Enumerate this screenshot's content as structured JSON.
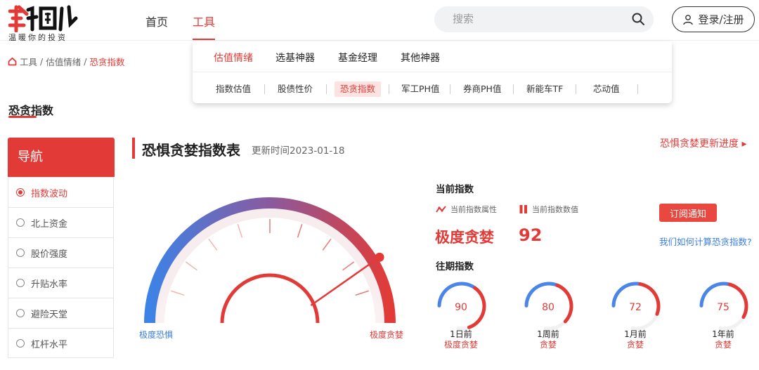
{
  "brand": {
    "logo_text": "韭圈儿",
    "slogan": "温暖你的投资"
  },
  "nav": {
    "home": "首页",
    "tools": "工具"
  },
  "search": {
    "placeholder": "搜索"
  },
  "auth": {
    "login_label": "登录/注册"
  },
  "dropdown": {
    "main": [
      "估值情绪",
      "选基神器",
      "基金经理",
      "其他神器"
    ],
    "sub": [
      "指数估值",
      "股债性价",
      "恐贪指数",
      "军工PH值",
      "券商PH值",
      "新能车TF",
      "芯动值"
    ]
  },
  "breadcrumb": [
    "工具",
    "估值情绪",
    "恐贪指数"
  ],
  "page_title": "恐贪指数",
  "sidebar": {
    "title": "导航",
    "items": [
      "指数波动",
      "北上资金",
      "股价强度",
      "升贴水率",
      "避险天堂",
      "杠杆水平"
    ]
  },
  "section": {
    "title": "恐惧贪婪指数表",
    "update_time": "更新时间2023-01-18",
    "progress_link": "恐惧贪婪更新进度 ▸"
  },
  "gauge": {
    "min_label": "极度恐惧",
    "max_label": "极度贪婪",
    "value": 92,
    "max": 100
  },
  "current": {
    "title": "当前指数",
    "attr_label": "当前指数属性",
    "value_label": "当前指数数值",
    "attr": "极度贪婪",
    "value": "92",
    "subscribe": "订阅通知",
    "how_link": "我们如何计算恐贪指数?"
  },
  "past": {
    "title": "往期指数",
    "items": [
      {
        "value": "90",
        "period": "1日前",
        "state": "极度贪婪"
      },
      {
        "value": "80",
        "period": "1周前",
        "state": "贪婪"
      },
      {
        "value": "72",
        "period": "1月前",
        "state": "贪婪"
      },
      {
        "value": "75",
        "period": "1年前",
        "state": "贪婪"
      }
    ]
  },
  "colors": {
    "accent": "#e23b37",
    "fear": "#3a7de0",
    "greed": "#e23b37"
  }
}
